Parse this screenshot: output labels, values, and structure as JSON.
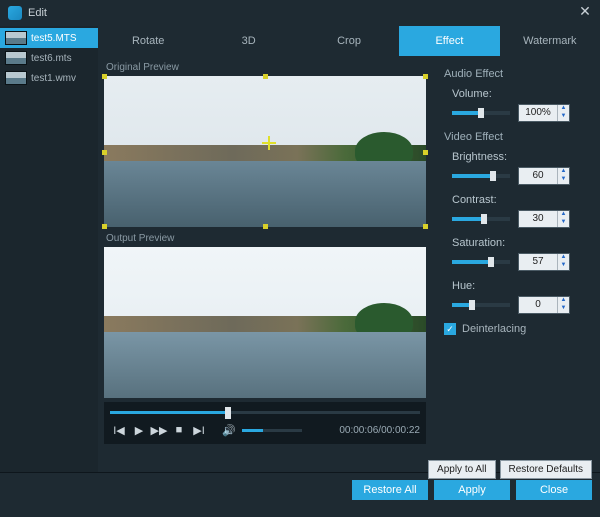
{
  "window": {
    "title": "Edit"
  },
  "files": [
    {
      "name": "test5.MTS",
      "selected": true
    },
    {
      "name": "test6.mts",
      "selected": false
    },
    {
      "name": "test1.wmv",
      "selected": false
    }
  ],
  "tabs": [
    {
      "label": "Rotate",
      "id": "rotate"
    },
    {
      "label": "3D",
      "id": "3d"
    },
    {
      "label": "Crop",
      "id": "crop"
    },
    {
      "label": "Effect",
      "id": "effect"
    },
    {
      "label": "Watermark",
      "id": "watermark"
    }
  ],
  "active_tab": "effect",
  "preview": {
    "original_label": "Original Preview",
    "output_label": "Output Preview"
  },
  "transport": {
    "position": "00:00:06",
    "duration": "00:00:22",
    "seek_pct": 38,
    "volume_pct": 35
  },
  "effects": {
    "audio_section": "Audio Effect",
    "video_section": "Video Effect",
    "volume": {
      "label": "Volume:",
      "value": 100,
      "unit": "%",
      "pct": 45
    },
    "brightness": {
      "label": "Brightness:",
      "value": 60,
      "pct": 65
    },
    "contrast": {
      "label": "Contrast:",
      "value": 30,
      "pct": 50
    },
    "saturation": {
      "label": "Saturation:",
      "value": 57,
      "pct": 62
    },
    "hue": {
      "label": "Hue:",
      "value": 0,
      "pct": 30
    },
    "deinterlacing": {
      "label": "Deinterlacing",
      "checked": true
    }
  },
  "buttons": {
    "apply_all": "Apply to All",
    "restore_defaults": "Restore Defaults",
    "restore_all": "Restore All",
    "apply": "Apply",
    "close": "Close"
  }
}
